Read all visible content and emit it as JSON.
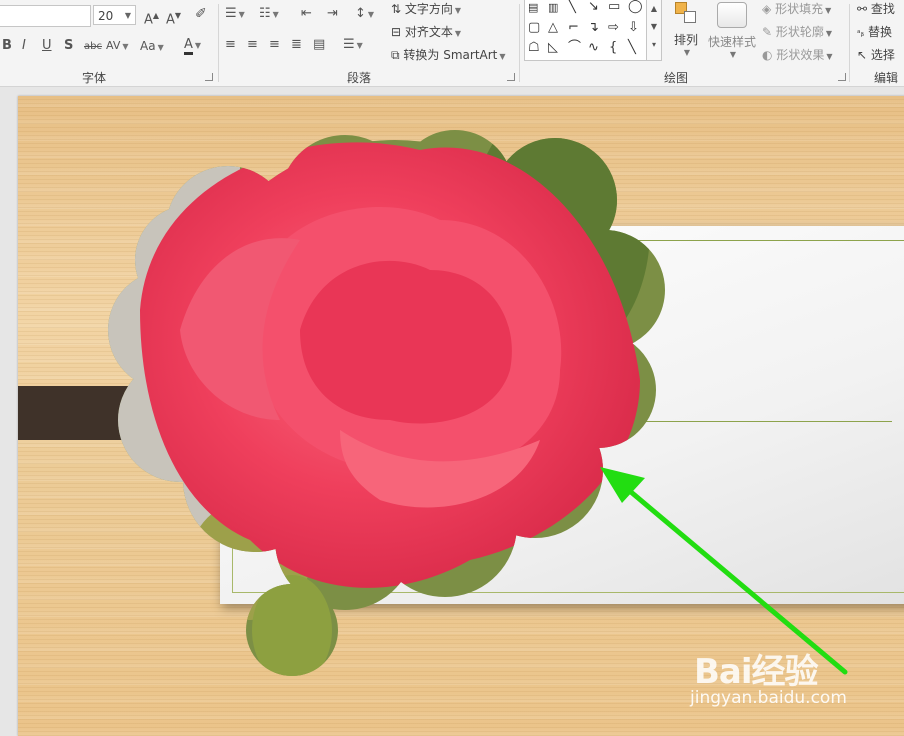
{
  "ribbon": {
    "font_group": {
      "label": "字体",
      "font_size": "20",
      "buttons": [
        "B",
        "I",
        "U",
        "S",
        "abc",
        "AV",
        "Aa",
        "A"
      ]
    },
    "paragraph_group": {
      "label": "段落",
      "text_direction": "文字方向",
      "align_text": "对齐文本",
      "convert_smartart": "转换为 SmartArt"
    },
    "drawing_group": {
      "label": "绘图",
      "arrange": "排列",
      "quick_styles": "快速样式",
      "shape_fill": "形状填充",
      "shape_outline": "形状轮廓",
      "shape_effects": "形状效果"
    },
    "editing_group": {
      "label": "编辑",
      "find": "查找",
      "replace": "替换",
      "select": "选择"
    }
  },
  "watermark": {
    "logo": "Bai经验",
    "url": "jingyan.baidu.com"
  },
  "colors": {
    "annotation_arrow": "#22dd11",
    "ribbon_bg": "#f4f4f4",
    "dark_bar": "#3f3229"
  }
}
